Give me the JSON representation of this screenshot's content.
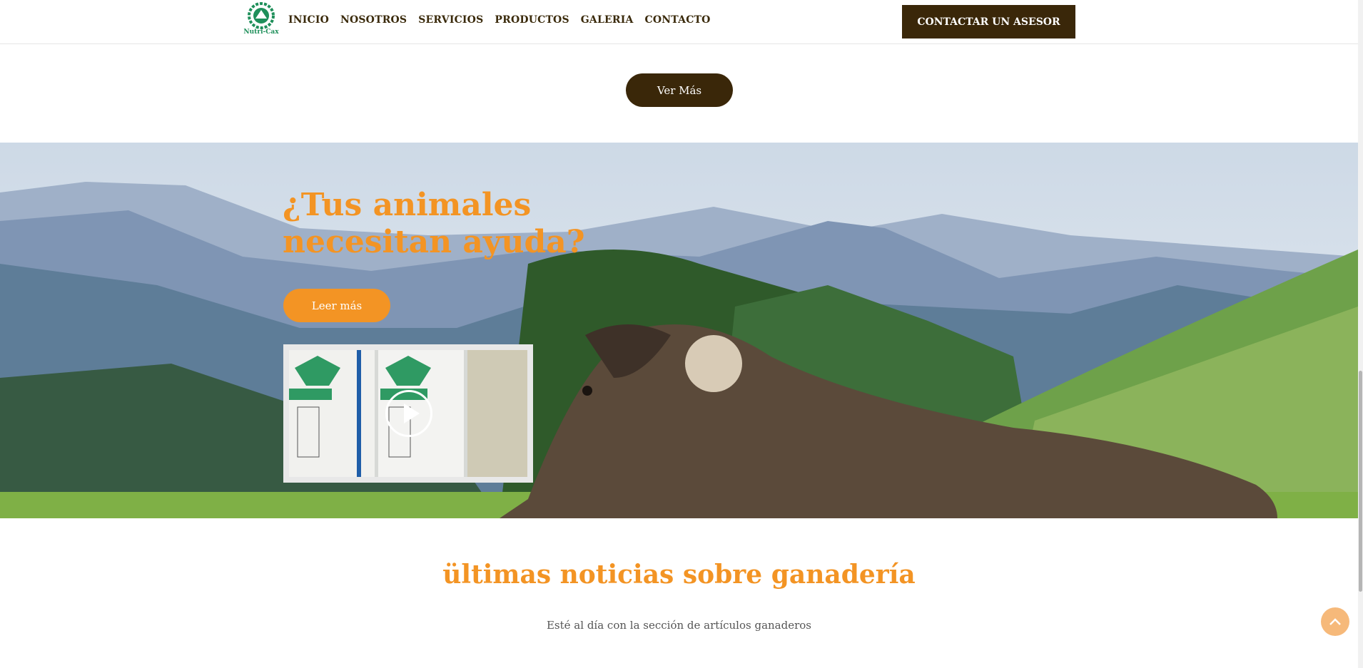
{
  "header": {
    "logo_text": "Nutri-Cax",
    "nav": [
      "INICIO",
      "NOSOTROS",
      "SERVICIOS",
      "PRODUCTOS",
      "GALERIA",
      "CONTACTO"
    ],
    "cta": "CONTACTAR UN ASESOR"
  },
  "ver_mas": "Ver Más",
  "hero": {
    "title": "¿Tus animales necesitan ayuda?",
    "button": "Leer más"
  },
  "news": {
    "title": "ültimas noticias sobre ganadería",
    "subtitle": "Esté al día con la sección de artículos ganaderos"
  },
  "colors": {
    "brand_dark": "#3a2709",
    "accent": "#f39424",
    "logo_green": "#1e8f5a"
  }
}
